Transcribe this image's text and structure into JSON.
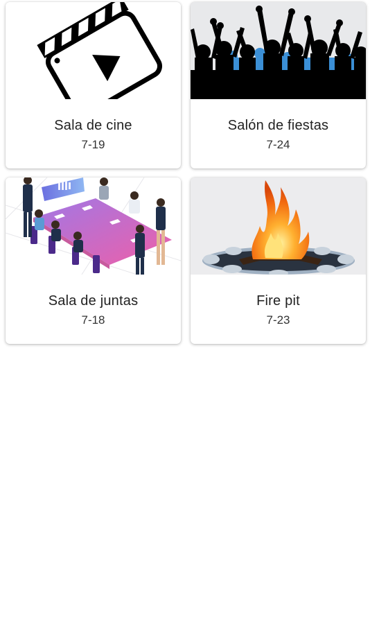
{
  "rooms": [
    {
      "name": "Sala de cine",
      "code": "7-19",
      "icon": "clapperboard-play-icon"
    },
    {
      "name": "Salón de fiestas",
      "code": "7-24",
      "icon": "party-crowd-image"
    },
    {
      "name": "Sala de juntas",
      "code": "7-18",
      "icon": "meeting-room-image"
    },
    {
      "name": "Fire pit",
      "code": "7-23",
      "icon": "fire-pit-image"
    }
  ]
}
